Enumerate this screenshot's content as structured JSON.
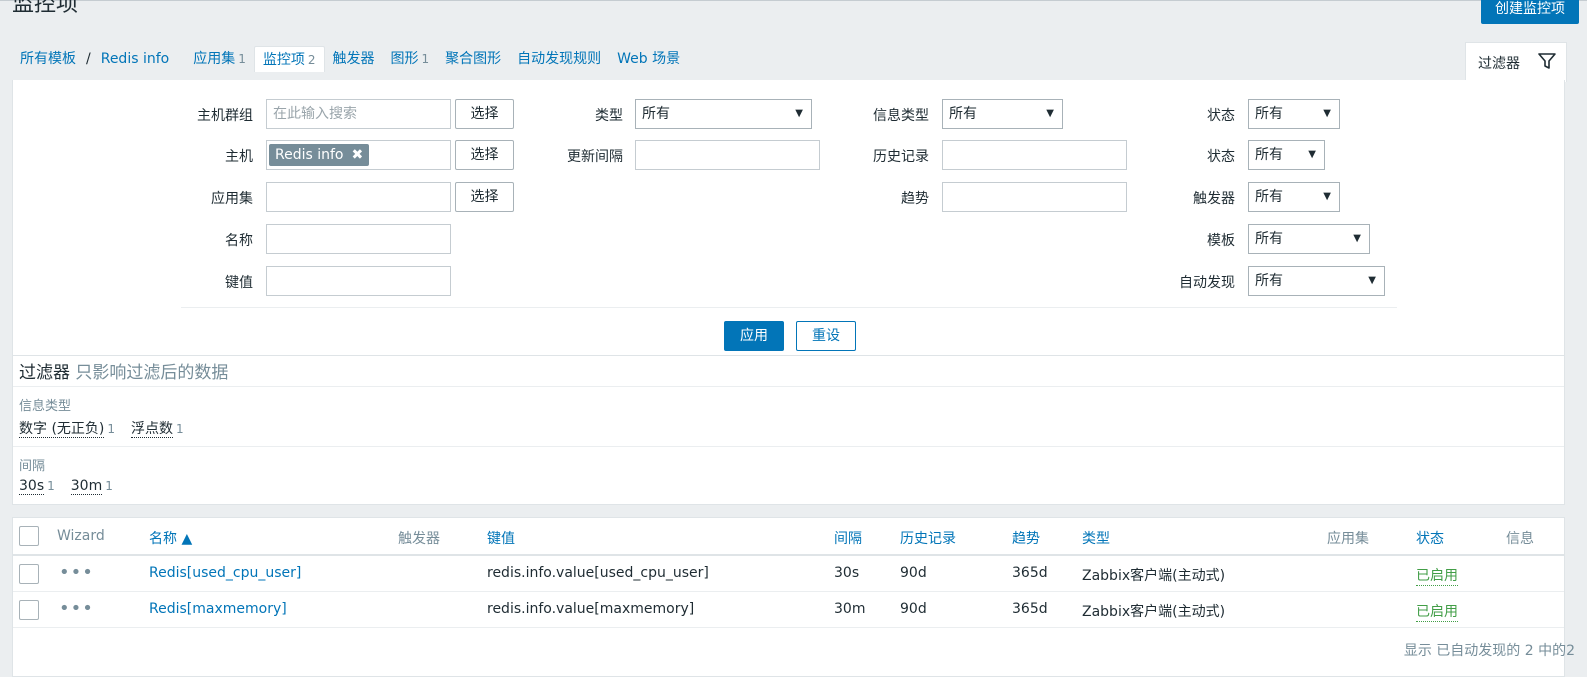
{
  "header": {
    "title": "监控项",
    "create_button": "创建监控项"
  },
  "breadcrumb": {
    "all_templates": "所有模板",
    "separator": "/",
    "template": "Redis info",
    "tabs": [
      {
        "label": "应用集",
        "count": "1"
      },
      {
        "label": "监控项",
        "count": "2"
      },
      {
        "label": "触发器",
        "count": ""
      },
      {
        "label": "图形",
        "count": "1"
      },
      {
        "label": "聚合图形",
        "count": ""
      },
      {
        "label": "自动发现规则",
        "count": ""
      },
      {
        "label": "Web 场景",
        "count": ""
      }
    ]
  },
  "filter_tab": {
    "label": "过滤器",
    "icon": "filter-icon"
  },
  "filter": {
    "host_group": {
      "label": "主机群组",
      "placeholder": "在此输入搜索",
      "button": "选择"
    },
    "host": {
      "label": "主机",
      "tag": "Redis info",
      "button": "选择"
    },
    "application": {
      "label": "应用集",
      "value": "",
      "button": "选择"
    },
    "name": {
      "label": "名称",
      "value": ""
    },
    "key": {
      "label": "键值",
      "value": ""
    },
    "type": {
      "label": "类型",
      "value": "所有"
    },
    "update_interval": {
      "label": "更新间隔",
      "value": ""
    },
    "info_type": {
      "label": "信息类型",
      "value": "所有"
    },
    "history": {
      "label": "历史记录",
      "value": ""
    },
    "trends": {
      "label": "趋势",
      "value": ""
    },
    "state": {
      "label": "状态",
      "value": "所有"
    },
    "status": {
      "label": "状态",
      "value": "所有"
    },
    "triggers": {
      "label": "触发器",
      "value": "所有"
    },
    "template": {
      "label": "模板",
      "value": "所有"
    },
    "discovery": {
      "label": "自动发现",
      "value": "所有"
    },
    "apply_button": "应用",
    "reset_button": "重设"
  },
  "subfilter": {
    "title": "过滤器",
    "subtitle": "只影响过滤后的数据",
    "groups": [
      {
        "label": "信息类型",
        "items": [
          {
            "value": "数字 (无正负)",
            "count": "1"
          },
          {
            "value": "浮点数",
            "count": "1"
          }
        ]
      },
      {
        "label": "间隔",
        "items": [
          {
            "value": "30s",
            "count": "1"
          },
          {
            "value": "30m",
            "count": "1"
          }
        ]
      }
    ]
  },
  "table": {
    "headers": {
      "wizard": "Wizard",
      "name": "名称 ▲",
      "triggers": "触发器",
      "key": "键值",
      "interval": "间隔",
      "history": "历史记录",
      "trends": "趋势",
      "type": "类型",
      "applications": "应用集",
      "status": "状态",
      "info": "信息"
    },
    "rows": [
      {
        "name": "Redis[used_cpu_user]",
        "key": "redis.info.value[used_cpu_user]",
        "interval": "30s",
        "history": "90d",
        "trends": "365d",
        "type": "Zabbix客户端(主动式)",
        "status": "已启用"
      },
      {
        "name": "Redis[maxmemory]",
        "key": "redis.info.value[maxmemory]",
        "interval": "30m",
        "history": "90d",
        "trends": "365d",
        "type": "Zabbix客户端(主动式)",
        "status": "已启用"
      }
    ],
    "footer": "显示 已自动发现的 2 中的2"
  }
}
